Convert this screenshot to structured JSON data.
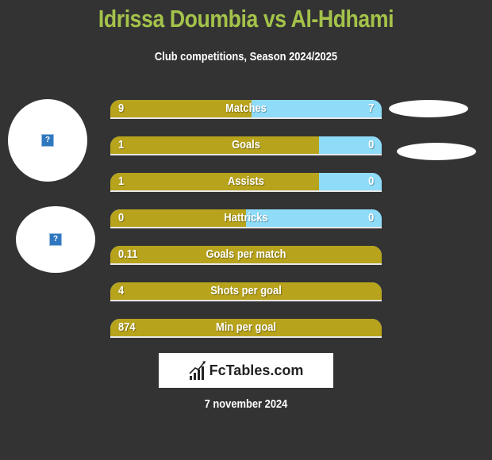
{
  "header": {
    "title": "Idrissa Doumbia vs Al-Hdhami",
    "subtitle": "Club competitions, Season 2024/2025"
  },
  "players": {
    "left_avatar_icon": "broken-image-icon",
    "right_avatar_icon": "broken-image-icon"
  },
  "colors": {
    "title": "#a4c34a",
    "left_bar": "#b8a31c",
    "right_bar": "#8fdcf9",
    "background": "#333333"
  },
  "stats": [
    {
      "label": "Matches",
      "left": "9",
      "right": "7",
      "left_share": 0.52,
      "two_sided": true
    },
    {
      "label": "Goals",
      "left": "1",
      "right": "0",
      "left_share": 0.77,
      "two_sided": true
    },
    {
      "label": "Assists",
      "left": "1",
      "right": "0",
      "left_share": 0.77,
      "two_sided": true
    },
    {
      "label": "Hattricks",
      "left": "0",
      "right": "0",
      "left_share": 0.5,
      "two_sided": true
    },
    {
      "label": "Goals per match",
      "left": "0.11",
      "right": "",
      "left_share": 1.0,
      "two_sided": false
    },
    {
      "label": "Shots per goal",
      "left": "4",
      "right": "",
      "left_share": 1.0,
      "two_sided": false
    },
    {
      "label": "Min per goal",
      "left": "874",
      "right": "",
      "left_share": 1.0,
      "two_sided": false
    }
  ],
  "footer": {
    "logo_text": "FcTables.com",
    "logo_icon": "bar-chart-growth-icon",
    "date": "7 november 2024"
  }
}
